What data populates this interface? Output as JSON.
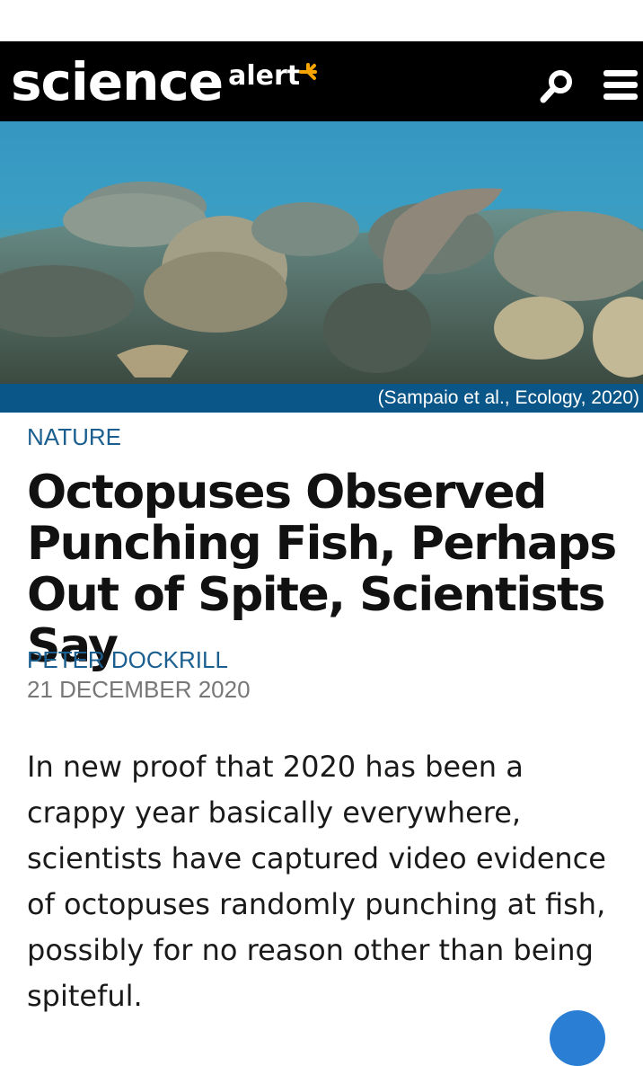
{
  "header": {
    "logo_main": "science",
    "logo_sub": "alert",
    "colors": {
      "background": "#000000",
      "logo_accent": "#f7a400"
    },
    "icons": {
      "search": "search-icon",
      "menu": "hamburger-menu-icon"
    }
  },
  "hero": {
    "caption": "(Sampaio et al., Ecology, 2020)"
  },
  "article": {
    "category": "NATURE",
    "headline": "Octopuses Observed Punching Fish, Perhaps Out of Spite, Scientists Say",
    "author": "PETER DOCKRILL",
    "date": "21 DECEMBER 2020",
    "lead": "In new proof that 2020 has been a crappy year basically everywhere, scientists have captured video evidence of octopuses randomly punching at fish, possibly for no reason other than being spiteful.",
    "colors": {
      "category": "#1a5f8f",
      "author": "#1a5f8f",
      "date": "#777777",
      "caption_bar": "#0b5688"
    }
  }
}
